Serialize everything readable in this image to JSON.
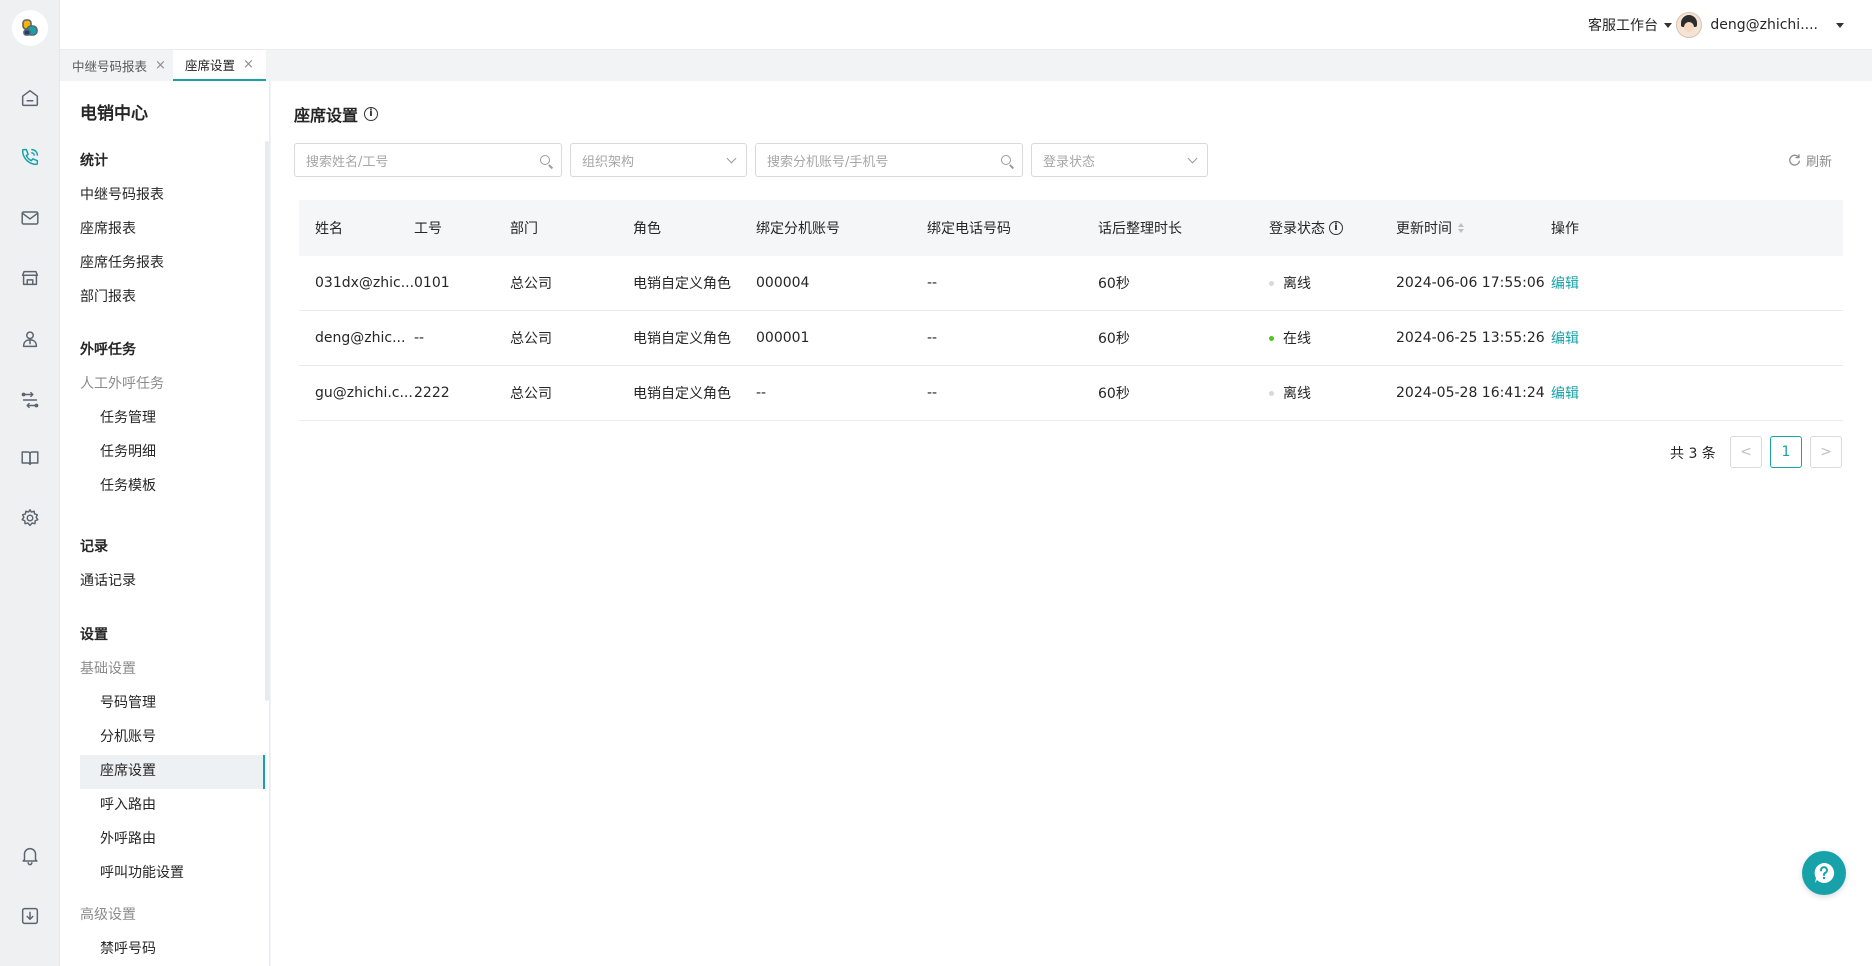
{
  "header": {
    "workbench_label": "客服工作台",
    "user_name": "deng@zhichi...."
  },
  "tabs": [
    {
      "label": "中继号码报表",
      "close": "×"
    },
    {
      "label": "座席设置",
      "close": "×"
    }
  ],
  "sidebar": {
    "title": "电销中心",
    "items": [
      {
        "label": "统计"
      },
      {
        "label": "中继号码报表"
      },
      {
        "label": "座席报表"
      },
      {
        "label": "座席任务报表"
      },
      {
        "label": "部门报表"
      },
      {
        "label": "外呼任务"
      },
      {
        "label": "人工外呼任务"
      },
      {
        "label": "任务管理"
      },
      {
        "label": "任务明细"
      },
      {
        "label": "任务模板"
      },
      {
        "label": "记录"
      },
      {
        "label": "通话记录"
      },
      {
        "label": "设置"
      },
      {
        "label": "基础设置"
      },
      {
        "label": "号码管理"
      },
      {
        "label": "分机账号"
      },
      {
        "label": "座席设置"
      },
      {
        "label": "呼入路由"
      },
      {
        "label": "外呼路由"
      },
      {
        "label": "呼叫功能设置"
      },
      {
        "label": "高级设置"
      },
      {
        "label": "禁呼号码"
      }
    ]
  },
  "page": {
    "title": "座席设置",
    "filters": {
      "name_placeholder": "搜索姓名/工号",
      "org_placeholder": "组织架构",
      "ext_placeholder": "搜索分机账号/手机号",
      "status_placeholder": "登录状态"
    },
    "refresh_label": "刷新"
  },
  "table": {
    "columns": [
      "姓名",
      "工号",
      "部门",
      "角色",
      "绑定分机账号",
      "绑定电话号码",
      "话后整理时长",
      "登录状态",
      "更新时间",
      "操作"
    ],
    "rows": [
      {
        "name": "031dx@zhic...",
        "id": "0101",
        "dept": "总公司",
        "role": "电销自定义角色",
        "ext": "000004",
        "phone": "--",
        "wrap": "60秒",
        "status": "离线",
        "status_color": "#d9d9d9",
        "updated": "2024-06-06 17:55:06",
        "action": "编辑"
      },
      {
        "name": "deng@zhic...",
        "id": "--",
        "dept": "总公司",
        "role": "电销自定义角色",
        "ext": "000001",
        "phone": "--",
        "wrap": "60秒",
        "status": "在线",
        "status_color": "#52c41a",
        "updated": "2024-06-25 13:55:26",
        "action": "编辑"
      },
      {
        "name": "gu@zhichi.c...",
        "id": "2222",
        "dept": "总公司",
        "role": "电销自定义角色",
        "ext": "--",
        "phone": "--",
        "wrap": "60秒",
        "status": "离线",
        "status_color": "#d9d9d9",
        "updated": "2024-05-28 16:41:24",
        "action": "编辑"
      }
    ]
  },
  "pagination": {
    "total_label": "共 3 条",
    "prev": "<",
    "current": "1",
    "next": ">"
  },
  "colors": {
    "accent": "#17a2a9",
    "online": "#52c41a",
    "offline": "#d9d9d9"
  }
}
